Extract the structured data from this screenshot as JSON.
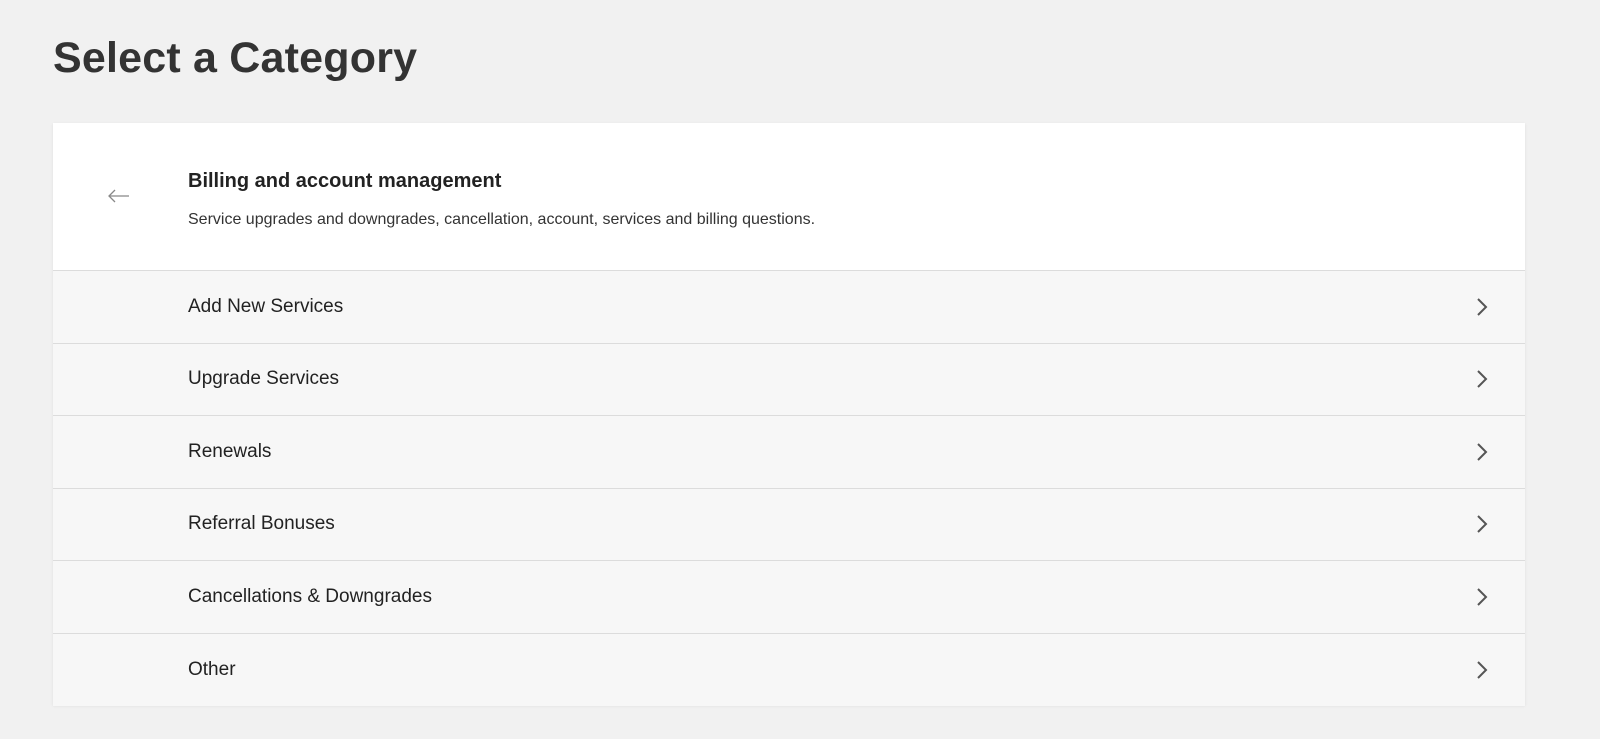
{
  "page": {
    "title": "Select a Category"
  },
  "category": {
    "back_icon": "arrow-left-icon",
    "title": "Billing and account management",
    "description": "Service upgrades and downgrades, cancellation, account, services and billing questions."
  },
  "items": [
    {
      "label": "Add New Services",
      "icon": "chevron-right-icon"
    },
    {
      "label": "Upgrade Services",
      "icon": "chevron-right-icon"
    },
    {
      "label": "Renewals",
      "icon": "chevron-right-icon"
    },
    {
      "label": "Referral Bonuses",
      "icon": "chevron-right-icon"
    },
    {
      "label": "Cancellations & Downgrades",
      "icon": "chevron-right-icon"
    },
    {
      "label": "Other",
      "icon": "chevron-right-icon"
    }
  ],
  "colors": {
    "page_background": "#f1f1f1",
    "card_background": "#ffffff",
    "item_background": "#f7f7f7",
    "divider": "#dcdcdc",
    "title_text": "#333333"
  }
}
